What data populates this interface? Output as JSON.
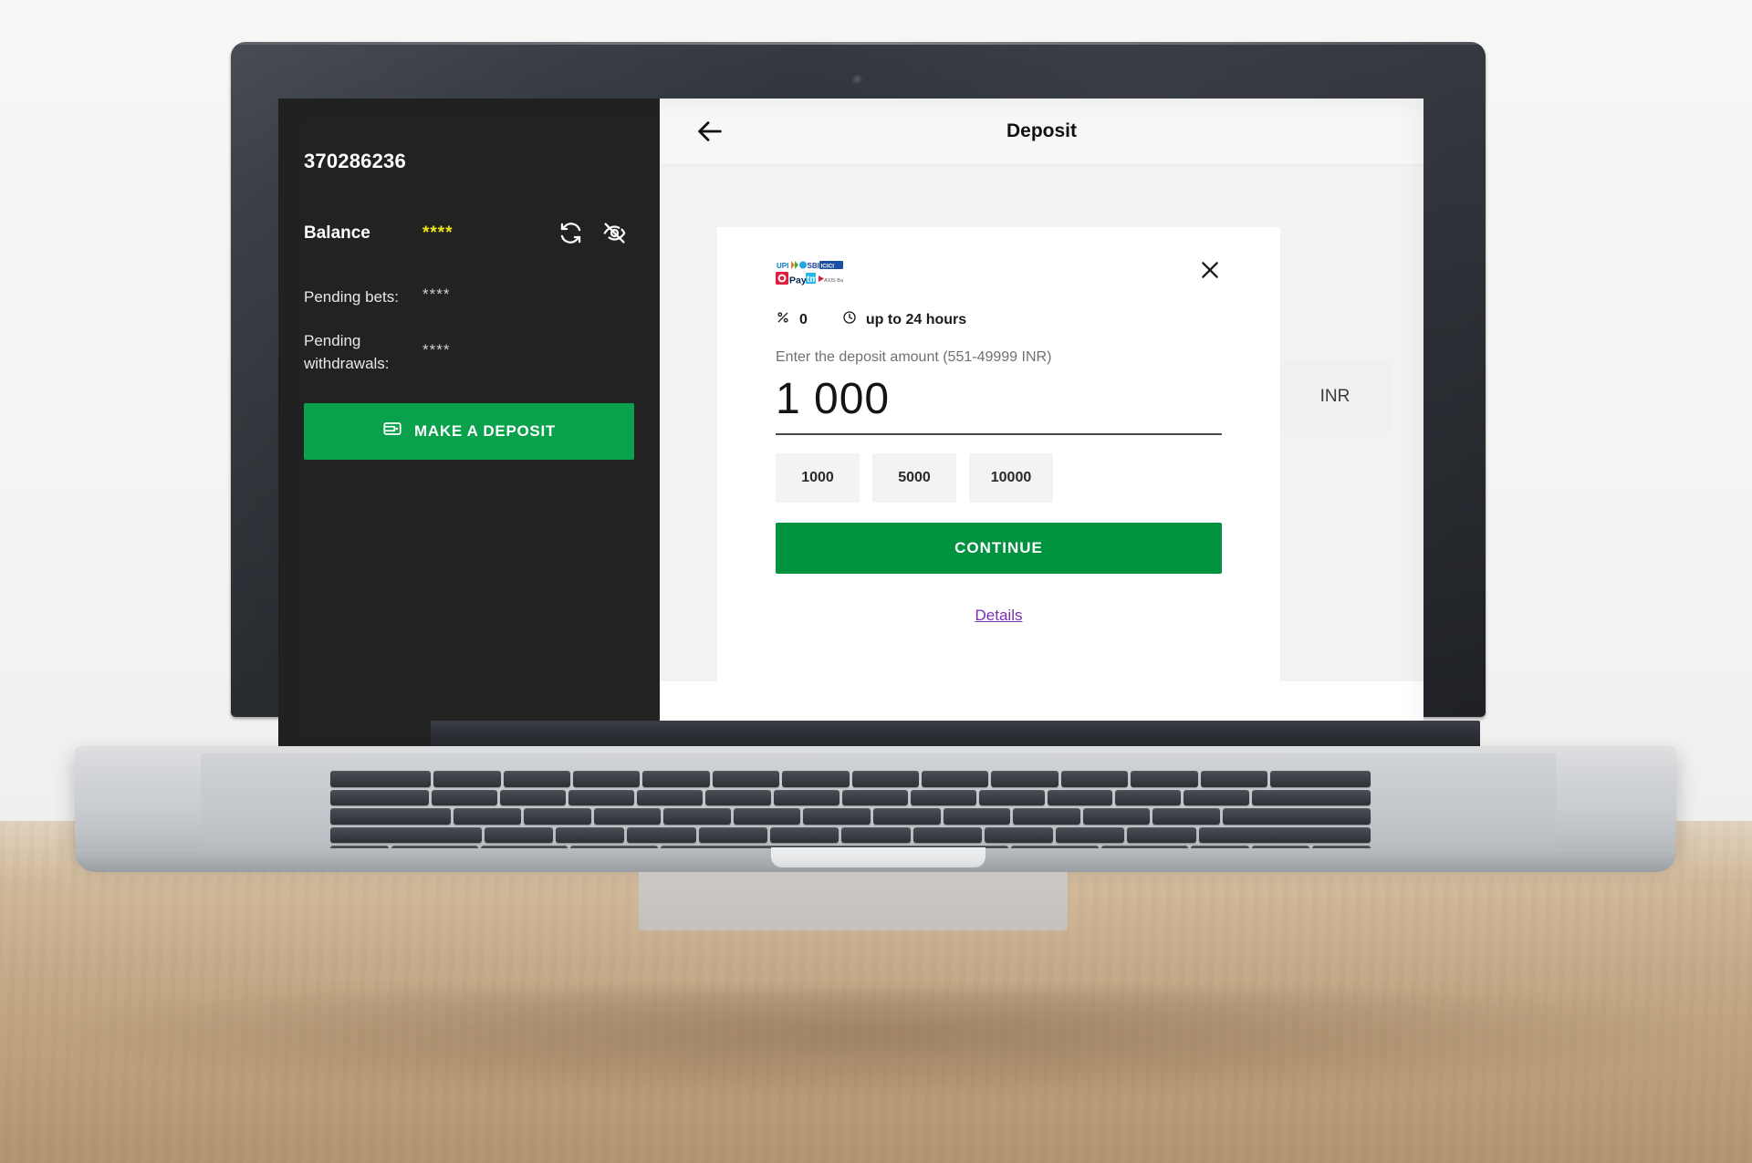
{
  "sidebar": {
    "account_id": "370286236",
    "balance_label": "Balance",
    "balance_value": "****",
    "balance_value_color": "#f2e41c",
    "refresh_icon": "refresh-icon",
    "hide_icon": "eye-off-icon",
    "rows": [
      {
        "label": "Pending bets:",
        "value": "****"
      },
      {
        "label": "Pending withdrawals:",
        "value": "****"
      }
    ],
    "deposit_button": {
      "label": "MAKE A DEPOSIT",
      "icon": "wallet-icon",
      "color": "#09a14c"
    }
  },
  "topbar": {
    "back_icon": "arrow-left-icon",
    "title": "Deposit"
  },
  "modal": {
    "payment_logo": "upi-sbi-paytm-logos",
    "close_icon": "close-icon",
    "fee": {
      "percent_icon": "percent-icon",
      "percent_value": "0",
      "clock_icon": "clock-icon",
      "duration": "up to 24 hours"
    },
    "hint": "Enter the deposit amount (551-49999 INR)",
    "amount_value": "1 000",
    "amount_placeholder": "0",
    "currency": "INR",
    "presets": [
      "1000",
      "5000",
      "10000"
    ],
    "continue_label": "CONTINUE",
    "details_label": "Details",
    "details_color": "#7a2fb0",
    "continue_color": "#00933f"
  }
}
